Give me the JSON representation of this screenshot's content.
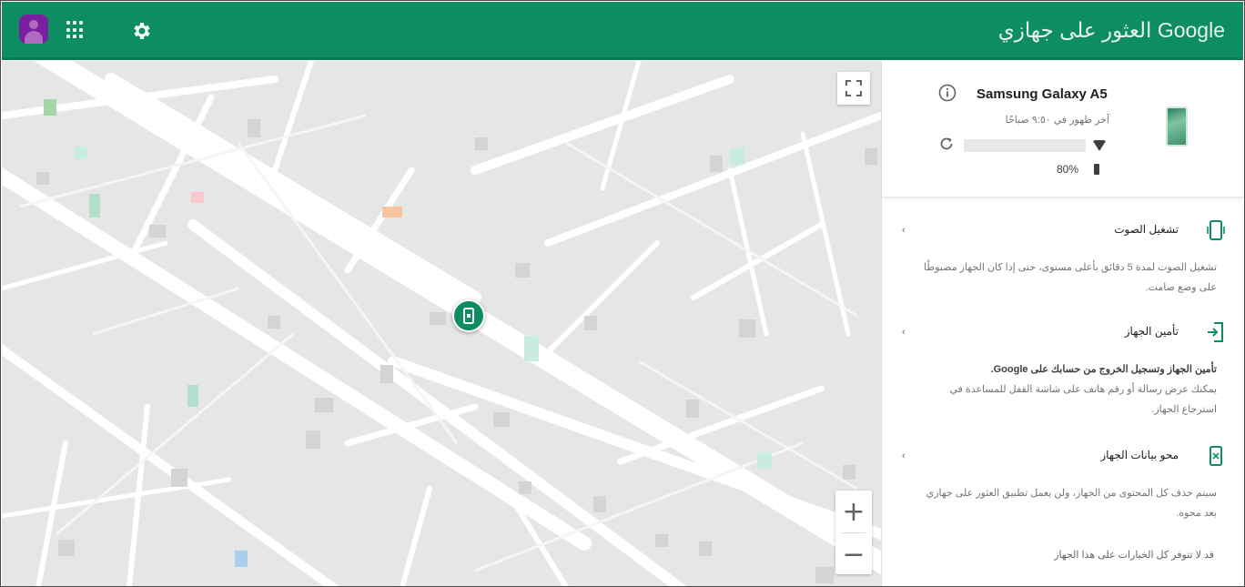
{
  "header": {
    "title": "Google العثور على جهازي",
    "brand_color": "#0f8d62",
    "icons": [
      "account-avatar",
      "apps-grid-icon",
      "settings-gear-icon"
    ]
  },
  "map": {
    "zoom_in_label": "+",
    "zoom_out_label": "−",
    "marker_icon": "phone-location-marker",
    "fullscreen_icon": "fullscreen-icon",
    "background_color": "#e5e5e5"
  },
  "device": {
    "name": "Samsung Galaxy A5",
    "last_seen": "آخر ظهور في ٩:٥٠ صباحًا",
    "battery": "80%",
    "network_icon": "wifi-icon",
    "info_icon": "info-icon",
    "refresh_icon": "refresh-icon"
  },
  "actions": [
    {
      "title": "تشغيل الصوت",
      "icon": "ring-phone-icon",
      "description": "تشغيل الصوت لمدة 5 دقائق بأعلى مستوى، حتى إذا كان الجهاز مضبوطًا على وضع صامت."
    },
    {
      "title": "تأمين الجهاز",
      "icon": "lock-device-icon",
      "description_bold": "تأمين الجهاز وتسجيل الخروج من حسابك على Google.",
      "description": "يمكنك عرض رسالة أو رقم هاتف على شاشة القفل للمساعدة في استرجاع الجهاز."
    },
    {
      "title": "محو بيانات الجهاز",
      "icon": "erase-device-icon",
      "description": "سيتم حذف كل المحتوى من الجهاز، ولن يعمل تطبيق العثور على جهازي بعد محوه."
    }
  ],
  "bottom_note": "قد لا تتوفر كل الخيارات على هذا الجهاز"
}
